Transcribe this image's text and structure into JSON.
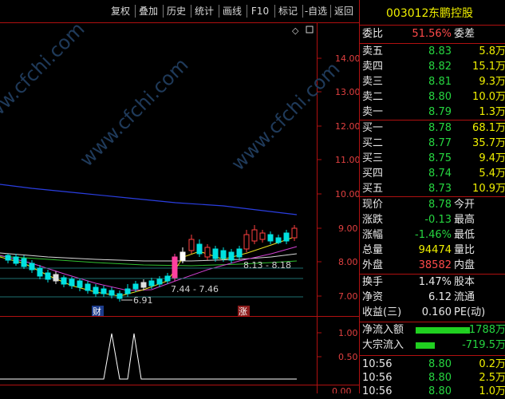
{
  "toolbar": {
    "items": [
      "复权",
      "叠加",
      "历史",
      "统计",
      "画线",
      "F10",
      "标记",
      "-自选",
      "返回"
    ]
  },
  "chart": {
    "price_ticks": [
      "14.00",
      "13.00",
      "12.00",
      "11.00",
      "10.00",
      "9.00",
      "8.00",
      "7.00"
    ],
    "indicator_ticks": [
      "1.00",
      "0.50"
    ],
    "bottom_tick": "0.00",
    "range_label_1": "7.44 - 7.46",
    "range_label_2": "8.13 - 8.18",
    "low_label": "6.91",
    "marker_cai": "财",
    "marker_zhang": "涨",
    "diamond_icon": "◇",
    "shrink_icon": "▢",
    "watermark": "www.cfchi.com"
  },
  "quote": {
    "code": "003012",
    "name": "东鹏控股",
    "weibi_label": "委比",
    "weibi_value": "51.56%",
    "weicha_label": "委差",
    "sell": [
      {
        "label": "卖五",
        "price": "8.83",
        "qty": "5.8万"
      },
      {
        "label": "卖四",
        "price": "8.82",
        "qty": "15.1万"
      },
      {
        "label": "卖三",
        "price": "8.81",
        "qty": "9.3万"
      },
      {
        "label": "卖二",
        "price": "8.80",
        "qty": "10.0万"
      },
      {
        "label": "卖一",
        "price": "8.79",
        "qty": "1.3万"
      }
    ],
    "buy": [
      {
        "label": "买一",
        "price": "8.78",
        "qty": "68.1万"
      },
      {
        "label": "买二",
        "price": "8.77",
        "qty": "35.7万"
      },
      {
        "label": "买三",
        "price": "8.75",
        "qty": "9.4万"
      },
      {
        "label": "买四",
        "price": "8.74",
        "qty": "5.4万"
      },
      {
        "label": "买五",
        "price": "8.73",
        "qty": "10.9万"
      }
    ],
    "stats": [
      {
        "l1": "现价",
        "v1": "8.78",
        "l2": "今开"
      },
      {
        "l1": "涨跌",
        "v1": "-0.13",
        "l2": "最高"
      },
      {
        "l1": "涨幅",
        "v1": "-1.46%",
        "l2": "最低"
      },
      {
        "l1": "总量",
        "v1": "94474",
        "l2": "量比"
      },
      {
        "l1": "外盘",
        "v1": "38582",
        "l2": "内盘"
      }
    ],
    "stats2": [
      {
        "l1": "换手",
        "v1": "1.47%",
        "l2": "股本"
      },
      {
        "l1": "净资",
        "v1": "6.12",
        "l2": "流通"
      },
      {
        "l1": "收益(三)",
        "v1": "0.160",
        "l2": "PE(动)"
      }
    ],
    "flows": [
      {
        "label": "净流入额",
        "value": "-1788万",
        "bar": 0.62
      },
      {
        "label": "大宗流入",
        "value": "-719.5万",
        "bar": 0.22
      }
    ],
    "ticks": [
      {
        "time": "10:56",
        "price": "8.80",
        "qty": "0.2万"
      },
      {
        "time": "10:56",
        "price": "8.80",
        "qty": "2.5万"
      },
      {
        "time": "10:56",
        "price": "8.80",
        "qty": "1.0万"
      }
    ]
  }
}
